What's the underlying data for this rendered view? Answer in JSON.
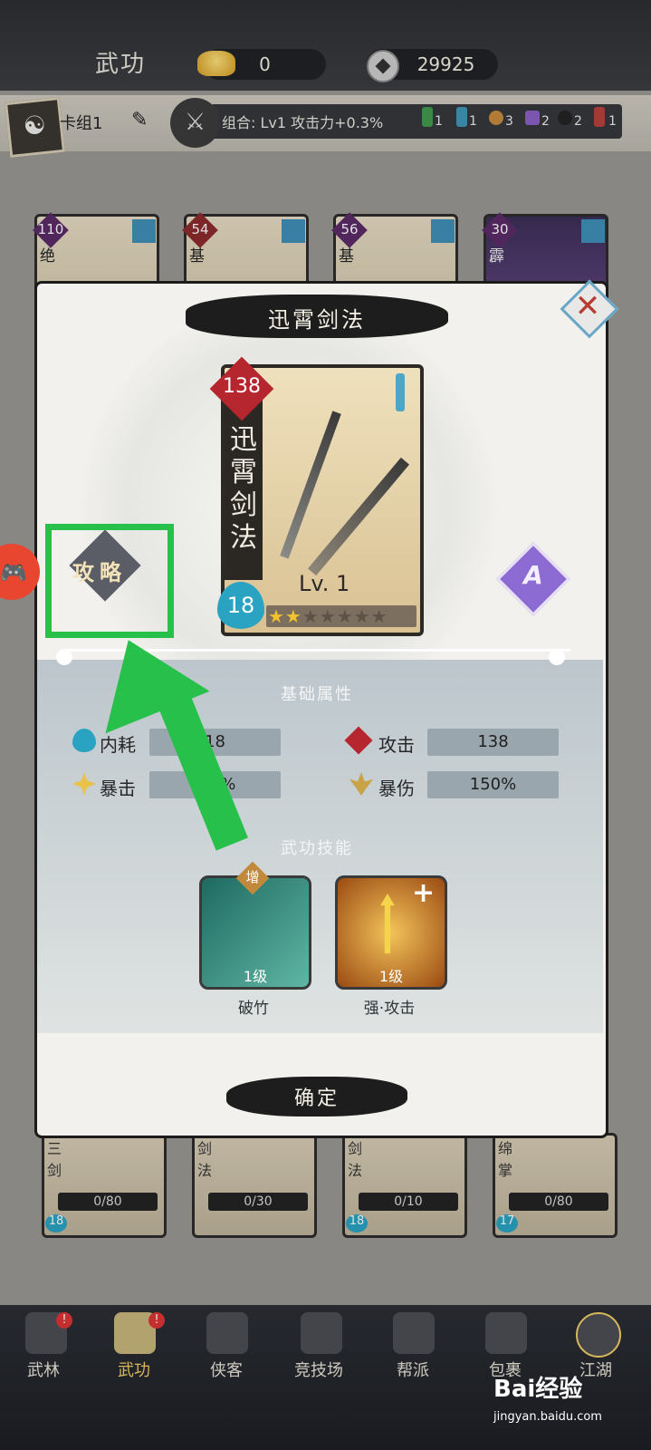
{
  "topbar": {
    "title": "武功",
    "gold": "0",
    "coins": "29925"
  },
  "deck": {
    "name": "卡组1",
    "combo": "组合: Lv1 攻击力+0.3%",
    "counts": [
      "1",
      "1",
      "3",
      "2",
      "2",
      "1"
    ]
  },
  "bg_cards_top": [
    {
      "cost": "110",
      "name": "绝"
    },
    {
      "cost": "54",
      "name": "基"
    },
    {
      "cost": "56",
      "name": "基"
    },
    {
      "cost": "30",
      "name": "霹"
    }
  ],
  "bg_cards_bottom": [
    {
      "name": "三剑",
      "progress": "0/80",
      "cost": "18"
    },
    {
      "name": "剑法",
      "progress": "0/30",
      "cost": ""
    },
    {
      "name": "剑法",
      "progress": "0/10",
      "cost": "18"
    },
    {
      "name": "绵掌",
      "progress": "0/80",
      "cost": "17"
    }
  ],
  "modal": {
    "title": "迅霄剑法",
    "card": {
      "name": "迅霄剑法",
      "attack": "138",
      "cost": "18",
      "level": "Lv. 1",
      "stars_filled": 2,
      "stars_total": 7,
      "stars_text": "★★★★★★★"
    },
    "guide_label": "攻略",
    "rank": "A",
    "basic_header": "基础属性",
    "stats": [
      {
        "label": "内耗",
        "value": "18"
      },
      {
        "label": "攻击",
        "value": "138"
      },
      {
        "label": "暴击",
        "value": "3.5%"
      },
      {
        "label": "暴伤",
        "value": "150%"
      }
    ],
    "skill_header": "武功技能",
    "skills": [
      {
        "name": "破竹",
        "level": "1级",
        "badge": "增"
      },
      {
        "name": "强·攻击",
        "level": "1级",
        "badge": "+"
      }
    ],
    "confirm": "确定"
  },
  "nav": [
    {
      "label": "武林"
    },
    {
      "label": "武功"
    },
    {
      "label": "侠客"
    },
    {
      "label": "竞技场"
    },
    {
      "label": "帮派"
    },
    {
      "label": "包裹"
    },
    {
      "label": "江湖"
    }
  ],
  "watermark": {
    "main": "Bai经验",
    "sub": "jingyan.baidu.com"
  },
  "colors": {
    "highlight": "#27c04a",
    "attack": "#b6262f",
    "cost": "#2aa3c2",
    "rank": "#8c6bd3"
  }
}
